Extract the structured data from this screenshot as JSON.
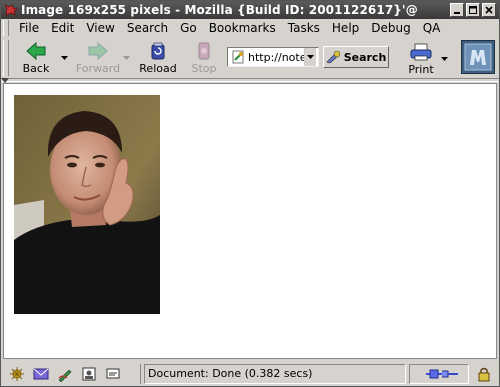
{
  "window": {
    "title": "Image 169x255 pixels - Mozilla {Build ID: 2001122617}'@"
  },
  "menubar": {
    "items": [
      {
        "label": "File"
      },
      {
        "label": "Edit"
      },
      {
        "label": "View"
      },
      {
        "label": "Search"
      },
      {
        "label": "Go"
      },
      {
        "label": "Bookmarks"
      },
      {
        "label": "Tasks"
      },
      {
        "label": "Help"
      },
      {
        "label": "Debug"
      },
      {
        "label": "QA"
      }
    ]
  },
  "toolbar": {
    "back_label": "Back",
    "forward_label": "Forward",
    "reload_label": "Reload",
    "stop_label": "Stop",
    "url_value": "http://noteb",
    "search_label": "Search",
    "print_label": "Print"
  },
  "content": {
    "image_desc_icon": "portrait-photo"
  },
  "statusbar": {
    "status_text": "Document: Done (0.382 secs)"
  },
  "colors": {
    "titlebar": "#4a4a4a",
    "chrome": "#d6d3ce",
    "logo": "#3f5f80",
    "back_arrow": "#2aa84a"
  }
}
